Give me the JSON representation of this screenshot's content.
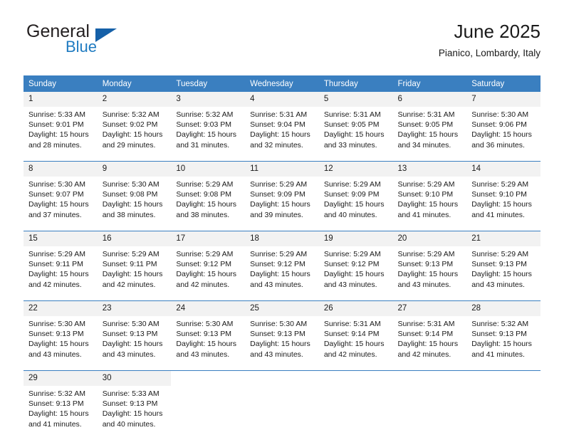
{
  "brand": {
    "word1": "General",
    "word2": "Blue",
    "triangle_color": "#1560a8",
    "blue_text_color": "#1f7bc1"
  },
  "header": {
    "title": "June 2025",
    "subtitle": "Pianico, Lombardy, Italy"
  },
  "theme": {
    "header_bg": "#3a7fc0",
    "header_text": "#ffffff",
    "daynum_bg": "#f2f2f2",
    "row_divider": "#3a7fc0"
  },
  "weekday_headers": [
    "Sunday",
    "Monday",
    "Tuesday",
    "Wednesday",
    "Thursday",
    "Friday",
    "Saturday"
  ],
  "weeks": [
    [
      {
        "day": "1",
        "sunrise": "Sunrise: 5:33 AM",
        "sunset": "Sunset: 9:01 PM",
        "daylight1": "Daylight: 15 hours",
        "daylight2": "and 28 minutes."
      },
      {
        "day": "2",
        "sunrise": "Sunrise: 5:32 AM",
        "sunset": "Sunset: 9:02 PM",
        "daylight1": "Daylight: 15 hours",
        "daylight2": "and 29 minutes."
      },
      {
        "day": "3",
        "sunrise": "Sunrise: 5:32 AM",
        "sunset": "Sunset: 9:03 PM",
        "daylight1": "Daylight: 15 hours",
        "daylight2": "and 31 minutes."
      },
      {
        "day": "4",
        "sunrise": "Sunrise: 5:31 AM",
        "sunset": "Sunset: 9:04 PM",
        "daylight1": "Daylight: 15 hours",
        "daylight2": "and 32 minutes."
      },
      {
        "day": "5",
        "sunrise": "Sunrise: 5:31 AM",
        "sunset": "Sunset: 9:05 PM",
        "daylight1": "Daylight: 15 hours",
        "daylight2": "and 33 minutes."
      },
      {
        "day": "6",
        "sunrise": "Sunrise: 5:31 AM",
        "sunset": "Sunset: 9:05 PM",
        "daylight1": "Daylight: 15 hours",
        "daylight2": "and 34 minutes."
      },
      {
        "day": "7",
        "sunrise": "Sunrise: 5:30 AM",
        "sunset": "Sunset: 9:06 PM",
        "daylight1": "Daylight: 15 hours",
        "daylight2": "and 36 minutes."
      }
    ],
    [
      {
        "day": "8",
        "sunrise": "Sunrise: 5:30 AM",
        "sunset": "Sunset: 9:07 PM",
        "daylight1": "Daylight: 15 hours",
        "daylight2": "and 37 minutes."
      },
      {
        "day": "9",
        "sunrise": "Sunrise: 5:30 AM",
        "sunset": "Sunset: 9:08 PM",
        "daylight1": "Daylight: 15 hours",
        "daylight2": "and 38 minutes."
      },
      {
        "day": "10",
        "sunrise": "Sunrise: 5:29 AM",
        "sunset": "Sunset: 9:08 PM",
        "daylight1": "Daylight: 15 hours",
        "daylight2": "and 38 minutes."
      },
      {
        "day": "11",
        "sunrise": "Sunrise: 5:29 AM",
        "sunset": "Sunset: 9:09 PM",
        "daylight1": "Daylight: 15 hours",
        "daylight2": "and 39 minutes."
      },
      {
        "day": "12",
        "sunrise": "Sunrise: 5:29 AM",
        "sunset": "Sunset: 9:09 PM",
        "daylight1": "Daylight: 15 hours",
        "daylight2": "and 40 minutes."
      },
      {
        "day": "13",
        "sunrise": "Sunrise: 5:29 AM",
        "sunset": "Sunset: 9:10 PM",
        "daylight1": "Daylight: 15 hours",
        "daylight2": "and 41 minutes."
      },
      {
        "day": "14",
        "sunrise": "Sunrise: 5:29 AM",
        "sunset": "Sunset: 9:10 PM",
        "daylight1": "Daylight: 15 hours",
        "daylight2": "and 41 minutes."
      }
    ],
    [
      {
        "day": "15",
        "sunrise": "Sunrise: 5:29 AM",
        "sunset": "Sunset: 9:11 PM",
        "daylight1": "Daylight: 15 hours",
        "daylight2": "and 42 minutes."
      },
      {
        "day": "16",
        "sunrise": "Sunrise: 5:29 AM",
        "sunset": "Sunset: 9:11 PM",
        "daylight1": "Daylight: 15 hours",
        "daylight2": "and 42 minutes."
      },
      {
        "day": "17",
        "sunrise": "Sunrise: 5:29 AM",
        "sunset": "Sunset: 9:12 PM",
        "daylight1": "Daylight: 15 hours",
        "daylight2": "and 42 minutes."
      },
      {
        "day": "18",
        "sunrise": "Sunrise: 5:29 AM",
        "sunset": "Sunset: 9:12 PM",
        "daylight1": "Daylight: 15 hours",
        "daylight2": "and 43 minutes."
      },
      {
        "day": "19",
        "sunrise": "Sunrise: 5:29 AM",
        "sunset": "Sunset: 9:12 PM",
        "daylight1": "Daylight: 15 hours",
        "daylight2": "and 43 minutes."
      },
      {
        "day": "20",
        "sunrise": "Sunrise: 5:29 AM",
        "sunset": "Sunset: 9:13 PM",
        "daylight1": "Daylight: 15 hours",
        "daylight2": "and 43 minutes."
      },
      {
        "day": "21",
        "sunrise": "Sunrise: 5:29 AM",
        "sunset": "Sunset: 9:13 PM",
        "daylight1": "Daylight: 15 hours",
        "daylight2": "and 43 minutes."
      }
    ],
    [
      {
        "day": "22",
        "sunrise": "Sunrise: 5:30 AM",
        "sunset": "Sunset: 9:13 PM",
        "daylight1": "Daylight: 15 hours",
        "daylight2": "and 43 minutes."
      },
      {
        "day": "23",
        "sunrise": "Sunrise: 5:30 AM",
        "sunset": "Sunset: 9:13 PM",
        "daylight1": "Daylight: 15 hours",
        "daylight2": "and 43 minutes."
      },
      {
        "day": "24",
        "sunrise": "Sunrise: 5:30 AM",
        "sunset": "Sunset: 9:13 PM",
        "daylight1": "Daylight: 15 hours",
        "daylight2": "and 43 minutes."
      },
      {
        "day": "25",
        "sunrise": "Sunrise: 5:30 AM",
        "sunset": "Sunset: 9:13 PM",
        "daylight1": "Daylight: 15 hours",
        "daylight2": "and 43 minutes."
      },
      {
        "day": "26",
        "sunrise": "Sunrise: 5:31 AM",
        "sunset": "Sunset: 9:14 PM",
        "daylight1": "Daylight: 15 hours",
        "daylight2": "and 42 minutes."
      },
      {
        "day": "27",
        "sunrise": "Sunrise: 5:31 AM",
        "sunset": "Sunset: 9:14 PM",
        "daylight1": "Daylight: 15 hours",
        "daylight2": "and 42 minutes."
      },
      {
        "day": "28",
        "sunrise": "Sunrise: 5:32 AM",
        "sunset": "Sunset: 9:13 PM",
        "daylight1": "Daylight: 15 hours",
        "daylight2": "and 41 minutes."
      }
    ],
    [
      {
        "day": "29",
        "sunrise": "Sunrise: 5:32 AM",
        "sunset": "Sunset: 9:13 PM",
        "daylight1": "Daylight: 15 hours",
        "daylight2": "and 41 minutes."
      },
      {
        "day": "30",
        "sunrise": "Sunrise: 5:33 AM",
        "sunset": "Sunset: 9:13 PM",
        "daylight1": "Daylight: 15 hours",
        "daylight2": "and 40 minutes."
      },
      {
        "day": "",
        "sunrise": "",
        "sunset": "",
        "daylight1": "",
        "daylight2": ""
      },
      {
        "day": "",
        "sunrise": "",
        "sunset": "",
        "daylight1": "",
        "daylight2": ""
      },
      {
        "day": "",
        "sunrise": "",
        "sunset": "",
        "daylight1": "",
        "daylight2": ""
      },
      {
        "day": "",
        "sunrise": "",
        "sunset": "",
        "daylight1": "",
        "daylight2": ""
      },
      {
        "day": "",
        "sunrise": "",
        "sunset": "",
        "daylight1": "",
        "daylight2": ""
      }
    ]
  ]
}
